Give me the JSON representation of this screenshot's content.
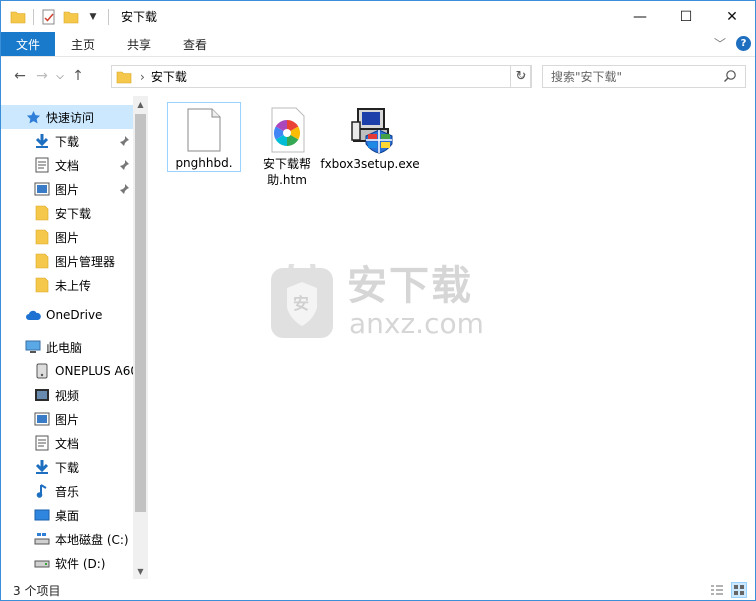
{
  "window": {
    "title": "安下载"
  },
  "titlebar": {
    "minimize": "—",
    "maximize": "☐",
    "close": "✕"
  },
  "ribbon": {
    "tabs": [
      "文件",
      "主页",
      "共享",
      "查看"
    ],
    "expand": "﹀",
    "help": "?"
  },
  "nav": {
    "back": "←",
    "forward": "→",
    "recent": "⌵",
    "up": "↑"
  },
  "address": {
    "path": "安下载",
    "separator": "›",
    "dropdown": "⌵",
    "refresh": "↻"
  },
  "search": {
    "placeholder": "搜索\"安下载\""
  },
  "sidebar": {
    "quick_access": "快速访问",
    "quick_items": [
      "下载",
      "文档",
      "图片",
      "安下载",
      "图片",
      "图片管理器",
      "未上传"
    ],
    "onedrive": "OneDrive",
    "this_pc": "此电脑",
    "pc_items": [
      "ONEPLUS A60",
      "视频",
      "图片",
      "文档",
      "下载",
      "音乐",
      "桌面",
      "本地磁盘 (C:)",
      "软件 (D:)"
    ]
  },
  "files": [
    {
      "name": "pnghhbd.",
      "icon": "blank-file-icon",
      "selected": true
    },
    {
      "name": "安下载帮助.htm",
      "icon": "htm-file-icon",
      "selected": false
    },
    {
      "name": "fxbox3setup.exe",
      "icon": "installer-exe-icon",
      "selected": false
    }
  ],
  "watermark": {
    "title": "安下载",
    "url": "anxz.com",
    "badge": "安"
  },
  "status": {
    "count": "3 个项目"
  },
  "colors": {
    "accent": "#1979ca",
    "selection": "#cce8ff",
    "selection_border": "#99d1ff"
  }
}
